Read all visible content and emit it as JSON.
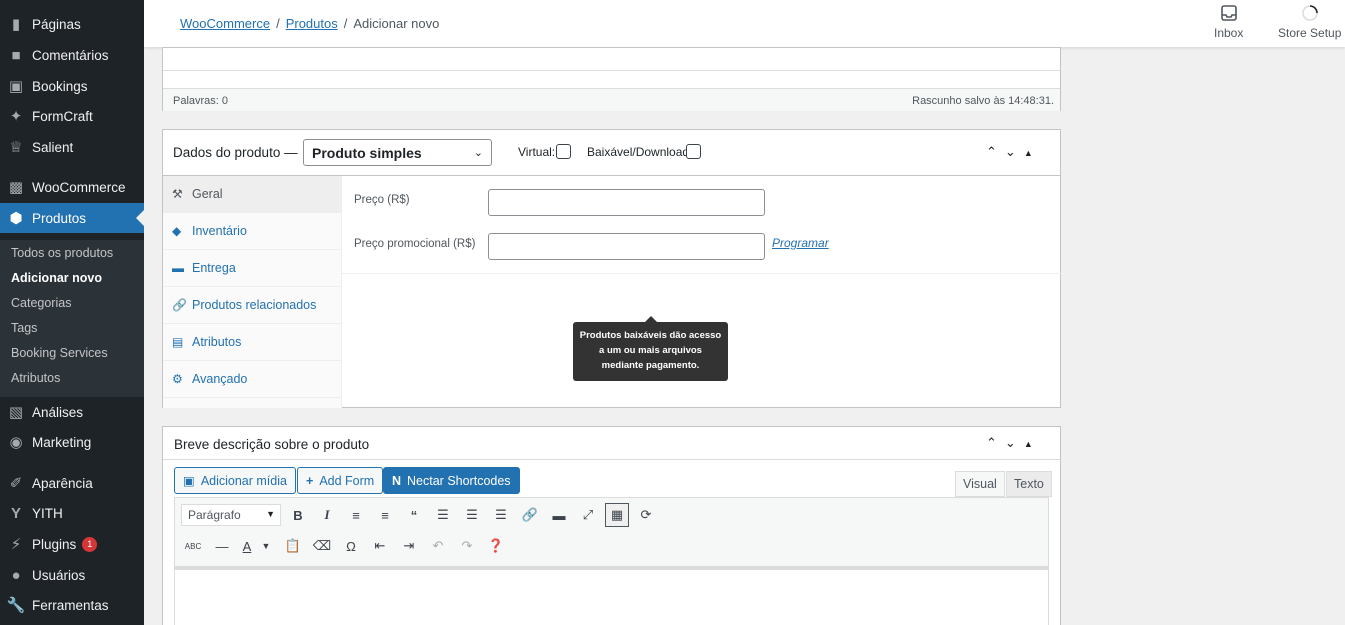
{
  "sidebar": {
    "items": [
      {
        "label": "Páginas",
        "icon": "pages-icon"
      },
      {
        "label": "Comentários",
        "icon": "comments-icon"
      },
      {
        "label": "Bookings",
        "icon": "calendar-icon"
      },
      {
        "label": "FormCraft",
        "icon": "formcraft-icon"
      },
      {
        "label": "Salient",
        "icon": "crown-icon"
      },
      {
        "label": "WooCommerce",
        "icon": "woo-icon"
      },
      {
        "label": "Produtos",
        "icon": "cube-icon"
      },
      {
        "label": "Análises",
        "icon": "chart-icon"
      },
      {
        "label": "Marketing",
        "icon": "megaphone-icon"
      },
      {
        "label": "Aparência",
        "icon": "brush-icon"
      },
      {
        "label": "YITH",
        "icon": "yith-icon"
      },
      {
        "label": "Plugins",
        "icon": "plug-icon",
        "badge": "1"
      },
      {
        "label": "Usuários",
        "icon": "users-icon"
      },
      {
        "label": "Ferramentas",
        "icon": "wrench-icon"
      }
    ],
    "submenu": [
      "Todos os produtos",
      "Adicionar novo",
      "Categorias",
      "Tags",
      "Booking Services",
      "Atributos"
    ]
  },
  "topbar": {
    "breadcrumb": [
      "WooCommerce",
      "Produtos",
      "Adicionar novo"
    ],
    "inbox_label": "Inbox",
    "store_setup_label": "Store Setup"
  },
  "editor_status": {
    "word_count": "Palavras: 0",
    "draft_saved": "Rascunho salvo às 14:48:31."
  },
  "product_data": {
    "title": "Dados do produto —",
    "type_selected": "Produto simples",
    "virtual_label": "Virtual:",
    "downloadable_label": "Baixável/Download:",
    "tabs": [
      {
        "label": "Geral",
        "icon": "wrench-icon"
      },
      {
        "label": "Inventário",
        "icon": "tag-icon"
      },
      {
        "label": "Entrega",
        "icon": "truck-icon"
      },
      {
        "label": "Produtos relacionados",
        "icon": "link-icon"
      },
      {
        "label": "Atributos",
        "icon": "list-icon"
      },
      {
        "label": "Avançado",
        "icon": "gear-icon"
      }
    ],
    "price_label": "Preço (R$)",
    "sale_price_label": "Preço promocional (R$)",
    "schedule_link": "Programar",
    "tooltip": "Produtos baixáveis dão acesso a um ou mais arquivos mediante pagamento."
  },
  "short_description": {
    "title": "Breve descrição sobre o produto",
    "add_media": "Adicionar mídia",
    "add_form": "Add Form",
    "nectar": "Nectar Shortcodes",
    "tab_visual": "Visual",
    "tab_text": "Texto",
    "format_select": "Parágrafo"
  },
  "colors": {
    "sidebar_bg": "#1d2327",
    "accent": "#2271b1",
    "badge": "#d63638"
  }
}
